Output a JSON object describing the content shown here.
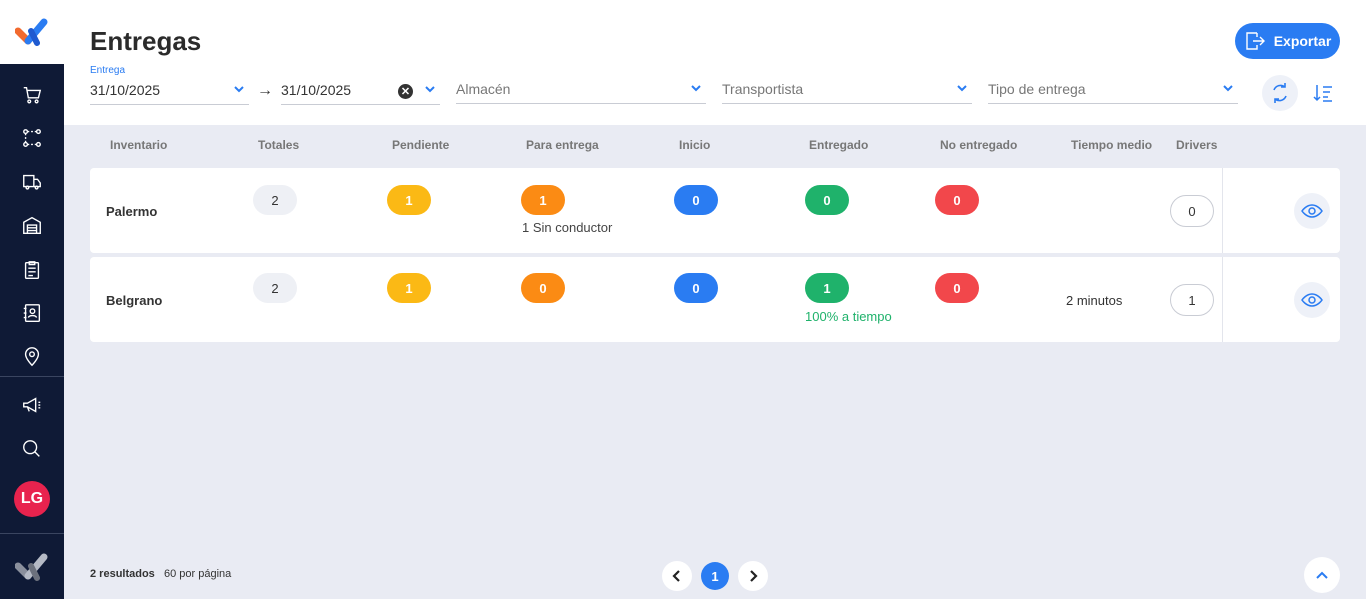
{
  "app": {
    "title": "Entregas",
    "export_label": "Exportar",
    "user_initials": "LG"
  },
  "sidebar": {
    "items": [
      {
        "icon": "cart-icon"
      },
      {
        "icon": "route-icon"
      },
      {
        "icon": "truck-icon"
      },
      {
        "icon": "warehouse-icon"
      },
      {
        "icon": "clipboard-icon"
      },
      {
        "icon": "contacts-icon"
      },
      {
        "icon": "location-pin-icon"
      },
      {
        "icon": "megaphone-icon"
      },
      {
        "icon": "search-icon"
      }
    ]
  },
  "filters": {
    "date_label": "Entrega",
    "date_from": "31/10/2025",
    "date_to": "31/10/2025",
    "warehouse_placeholder": "Almacén",
    "carrier_placeholder": "Transportista",
    "delivery_type_placeholder": "Tipo de entrega"
  },
  "table": {
    "headers": [
      "Inventario",
      "Totales",
      "Pendiente",
      "Para entrega",
      "Inicio",
      "Entregado",
      "No entregado",
      "Tiempo medio",
      "Drivers"
    ],
    "rows": [
      {
        "name": "Palermo",
        "totales": "2",
        "pendiente": "1",
        "para_entrega": "1",
        "para_entrega_note": "1 Sin conductor",
        "inicio": "0",
        "entregado": "0",
        "entregado_note": "",
        "no_entregado": "0",
        "tiempo_medio": "",
        "drivers": "0"
      },
      {
        "name": "Belgrano",
        "totales": "2",
        "pendiente": "1",
        "para_entrega": "0",
        "para_entrega_note": "",
        "inicio": "0",
        "entregado": "1",
        "entregado_note": "100% a tiempo",
        "no_entregado": "0",
        "tiempo_medio": "2 minutos",
        "drivers": "1"
      }
    ]
  },
  "footer": {
    "results_count": "2 resultados",
    "per_page": "60 por página",
    "current_page": "1"
  },
  "colors": {
    "accent": "#2a7cf2",
    "sidebar": "#0f1a36",
    "pending": "#fbb915",
    "for_delivery": "#fb8b14",
    "started": "#2a7cf2",
    "delivered": "#1fb26b",
    "not_delivered": "#f2474b"
  }
}
